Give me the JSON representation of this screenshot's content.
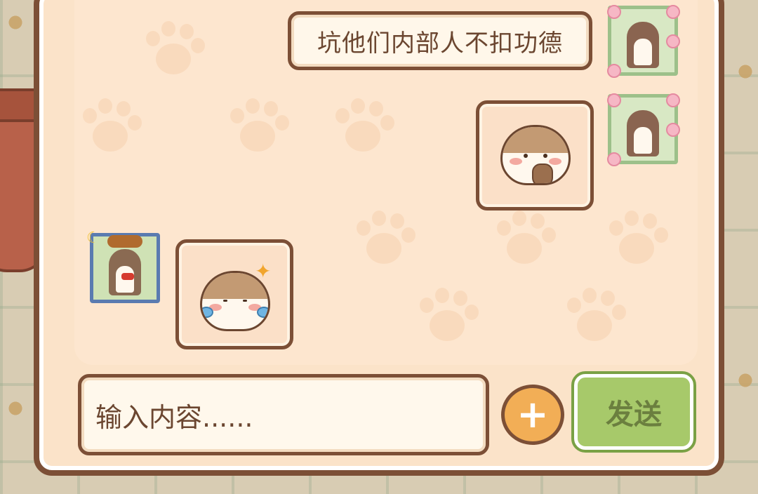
{
  "chat": {
    "messages": [
      {
        "side": "right",
        "type": "text",
        "text": "坑他们内部人不扣功德",
        "avatar": "otter-flower-avatar"
      },
      {
        "side": "right",
        "type": "sticker",
        "sticker": "otter-holding-nut-sticker",
        "avatar": "otter-flower-avatar"
      },
      {
        "side": "left",
        "type": "sticker",
        "sticker": "otter-laughing-tears-sticker",
        "avatar": "otter-witch-hat-avatar"
      }
    ]
  },
  "input": {
    "placeholder": "输入内容......"
  },
  "buttons": {
    "plus_icon": "+",
    "send_label": "发送"
  },
  "colors": {
    "panel_border": "#7c4f36",
    "panel_bg": "#fbe3c9",
    "send_button": "#a7c96a",
    "plus_button": "#f2ae56"
  }
}
